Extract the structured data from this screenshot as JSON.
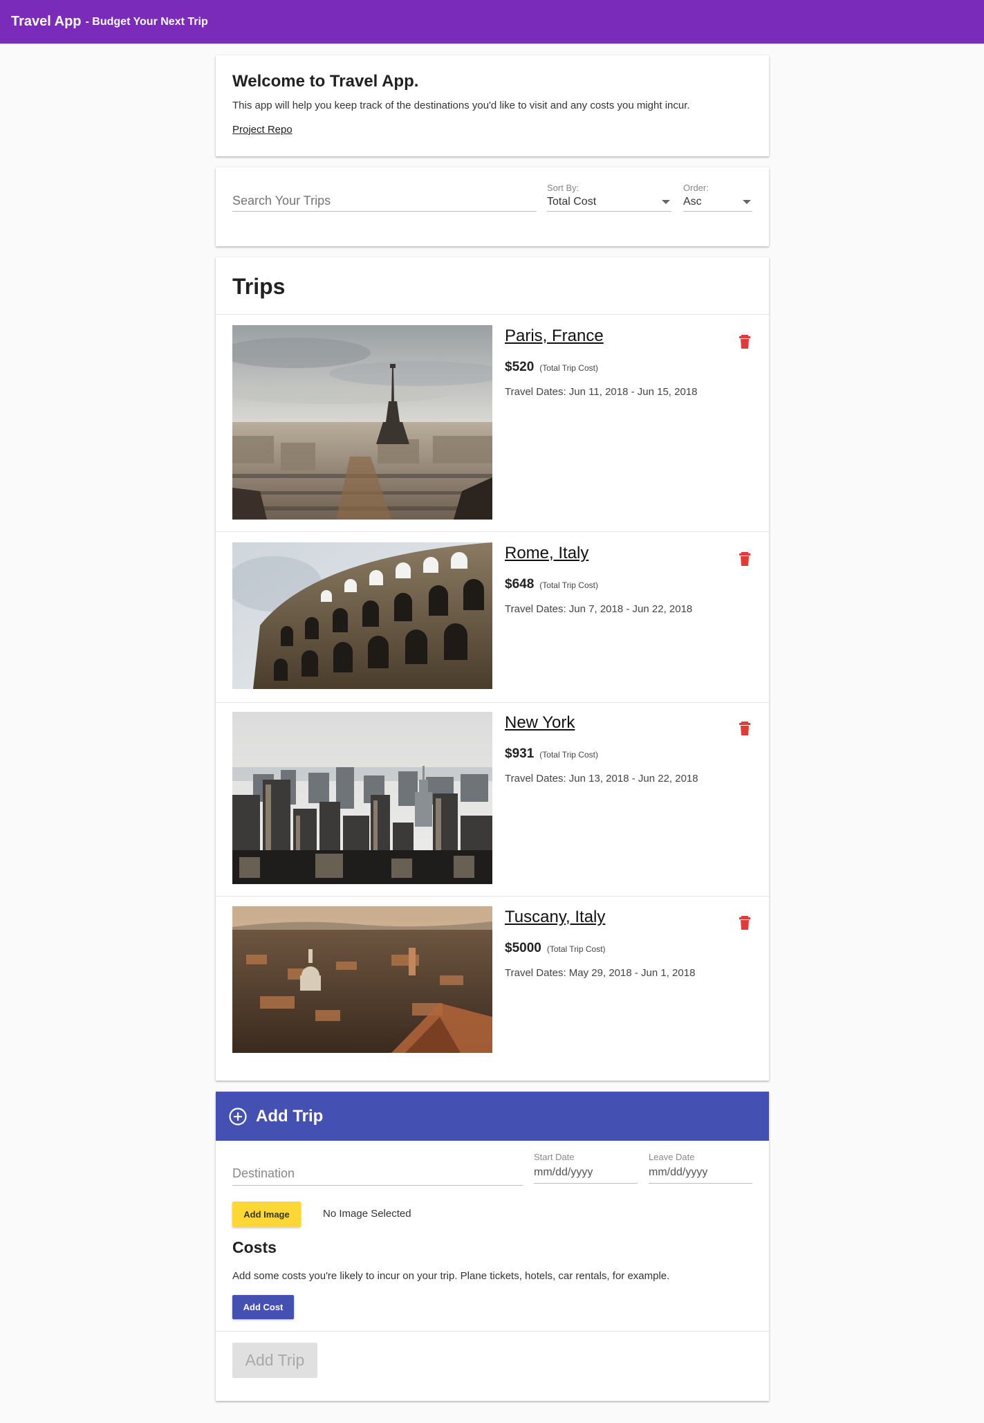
{
  "appbar": {
    "title": "Travel App",
    "subtitle": "- Budget Your Next Trip"
  },
  "welcome": {
    "heading": "Welcome to Travel App.",
    "text": "This app will help you keep track of the destinations you'd like to visit and any costs you might incur.",
    "link": "Project Repo"
  },
  "search": {
    "placeholder": "Search Your Trips",
    "sort_label": "Sort By:",
    "sort_value": "Total Cost",
    "order_label": "Order:",
    "order_value": "Asc"
  },
  "trips": {
    "heading": "Trips",
    "cost_note": "(Total Trip Cost)",
    "items": [
      {
        "name": "Paris, France",
        "cost": "$520",
        "dates": "Travel Dates: Jun 11, 2018 - Jun 15, 2018",
        "photo": "eiffel-tower-cityscape"
      },
      {
        "name": "Rome, Italy",
        "cost": "$648",
        "dates": "Travel Dates: Jun 7, 2018 - Jun 22, 2018",
        "photo": "colosseum"
      },
      {
        "name": "New York",
        "cost": "$931",
        "dates": "Travel Dates: Jun 13, 2018 - Jun 22, 2018",
        "photo": "manhattan-skyline"
      },
      {
        "name": "Tuscany, Italy",
        "cost": "$5000",
        "dates": "Travel Dates: May 29, 2018 - Jun 1, 2018",
        "photo": "tuscany-town-sunset"
      }
    ]
  },
  "add_trip": {
    "header": "Add Trip",
    "destination_placeholder": "Destination",
    "start_label": "Start Date",
    "start_placeholder": "mm/dd/yyyy",
    "leave_label": "Leave Date",
    "leave_placeholder": "mm/dd/yyyy",
    "add_image": "Add Image",
    "no_image": "No Image Selected",
    "costs_heading": "Costs",
    "costs_text": "Add some costs you're likely to incur on your trip. Plane tickets, hotels, car rentals, for example.",
    "add_cost": "Add Cost",
    "submit": "Add Trip"
  },
  "colors": {
    "appbar": "#7b2bb9",
    "add_trip_header": "#4550b3",
    "add_image_button": "#fdd835",
    "delete_icon": "#e53935"
  }
}
